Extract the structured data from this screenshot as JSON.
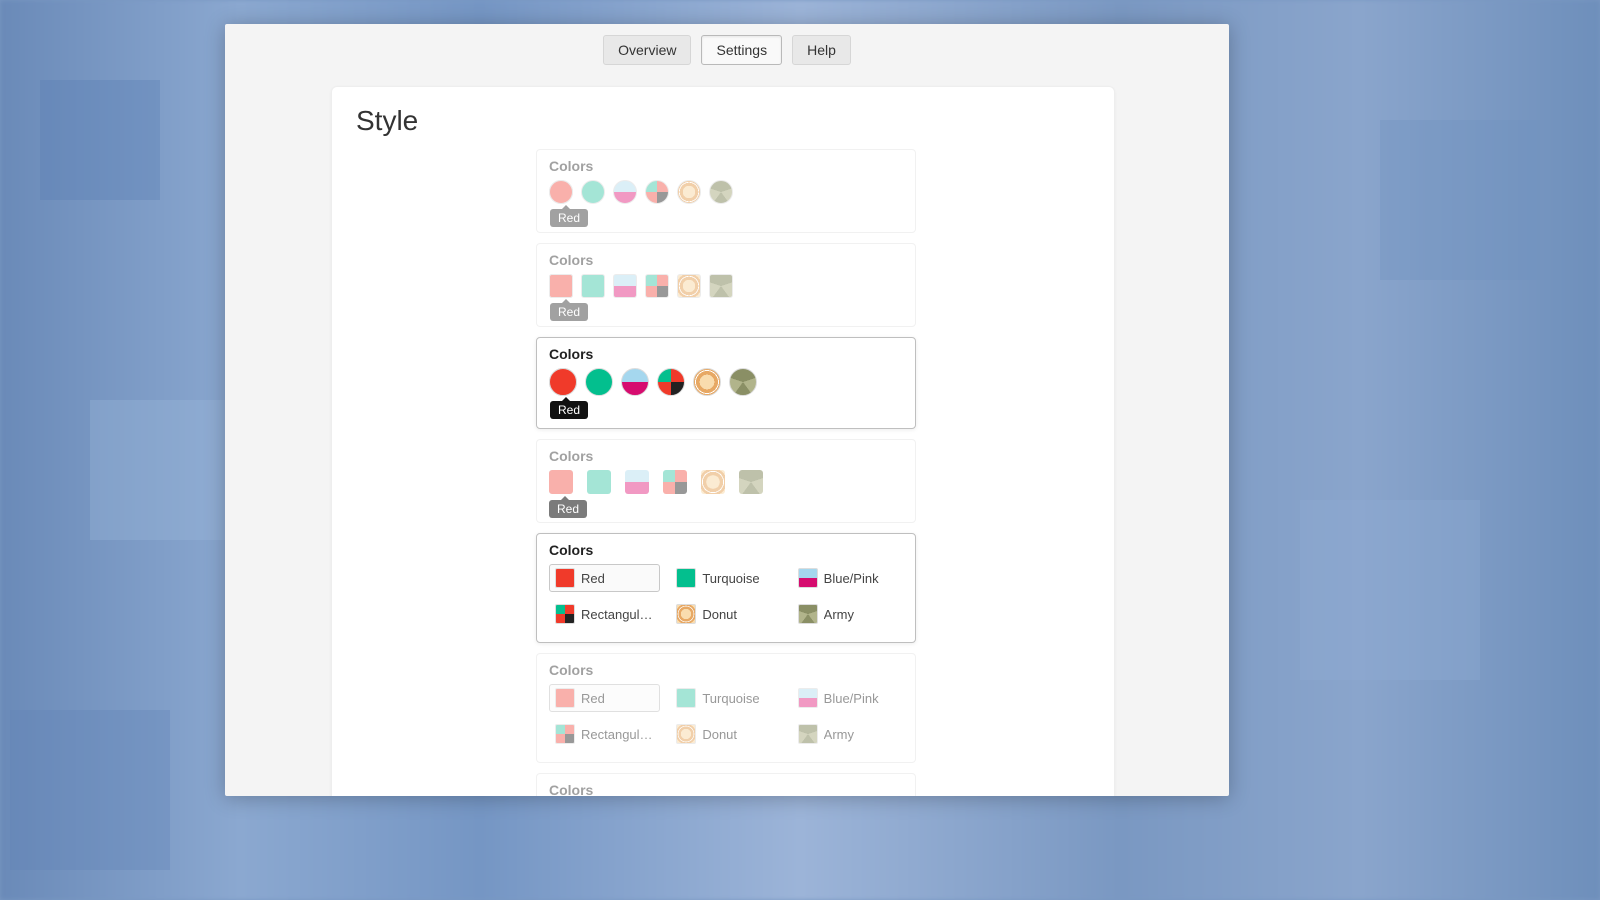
{
  "tabs": {
    "overview": "Overview",
    "settings": "Settings",
    "help": "Help",
    "active": "settings"
  },
  "page_title": "Style",
  "colors_label": "Colors",
  "tooltip_red": "Red",
  "swatch_names": {
    "red": "Red",
    "turquoise": "Turquoise",
    "bluepink": "Blue/Pink",
    "rect": "Rectangular P...",
    "donut": "Donut",
    "army": "Army"
  }
}
